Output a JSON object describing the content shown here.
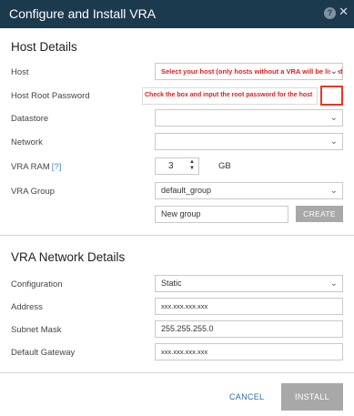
{
  "window": {
    "title": "Configure and Install VRA",
    "help_label": "?",
    "close_label": "✕"
  },
  "host_details": {
    "title": "Host Details",
    "host": {
      "label": "Host",
      "value": "Select your host (only hosts without a VRA will be listed"
    },
    "host_root_password": {
      "label": "Host Root Password",
      "annotation": "Check the box and input the root password for the host"
    },
    "datastore": {
      "label": "Datastore",
      "value": ""
    },
    "network": {
      "label": "Network",
      "value": ""
    },
    "vra_ram": {
      "label": "VRA RAM",
      "hint": "[?]",
      "value": "3",
      "unit": "GB"
    },
    "vra_group": {
      "label": "VRA Group",
      "value": "default_group",
      "new_group_value": "New group",
      "create_label": "CREATE"
    }
  },
  "network_details": {
    "title": "VRA Network Details",
    "configuration": {
      "label": "Configuration",
      "value": "Static"
    },
    "address": {
      "label": "Address",
      "value": "xxx.xxx.xxx.xxx"
    },
    "subnet_mask": {
      "label": "Subnet Mask",
      "value": "255.255.255.0"
    },
    "default_gateway": {
      "label": "Default Gateway",
      "value": "xxx.xxx.xxx.xxx"
    }
  },
  "footer": {
    "cancel_label": "CANCEL",
    "install_label": "INSTALL"
  }
}
